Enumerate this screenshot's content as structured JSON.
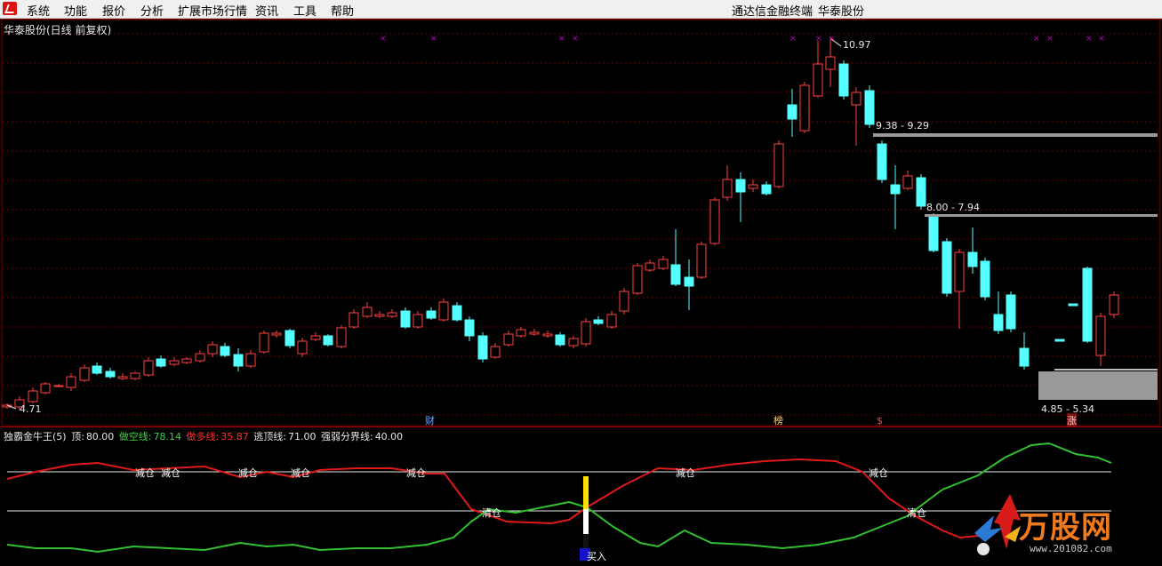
{
  "menu": {
    "items": [
      "系统",
      "功能",
      "报价",
      "分析",
      "扩展市场行情",
      "资讯",
      "工具",
      "帮助"
    ],
    "app_title": "通达信金融终端",
    "stock_name": "华泰股份"
  },
  "main_chart": {
    "title": "华泰股份(日线 前复权)",
    "high_label": "10.97",
    "low_label": "4.71",
    "zones": [
      {
        "label": "9.38 - 9.29"
      },
      {
        "label": "8.00 - 7.94"
      },
      {
        "label": "4.85 - 5.34"
      }
    ],
    "bottom_markers": [
      "财",
      "榜",
      "$",
      "涨"
    ],
    "colors": {
      "up": "#ff4040",
      "down": "#54ffff",
      "grid": "#6a0000",
      "zone": "#9a9a9a"
    }
  },
  "indicator": {
    "name": "独霸金牛王(5)",
    "params": [
      {
        "label": "顶:",
        "value": "80.00",
        "color": "#e6e6e6"
      },
      {
        "label": "做空线:",
        "value": "78.14",
        "color": "#40d040"
      },
      {
        "label": "做多线:",
        "value": "35.87",
        "color": "#ff3030"
      },
      {
        "label": "逃顶线:",
        "value": "71.00",
        "color": "#e6e6e6"
      },
      {
        "label": "强弱分界线:",
        "value": "40.00",
        "color": "#e6e6e6"
      }
    ],
    "jiancang_labels": [
      "减仓",
      "减仓",
      "减仓",
      "减仓",
      "减仓",
      "减仓",
      "减仓"
    ],
    "qingcang_labels": [
      "清仓",
      "清仓"
    ],
    "buy_label": "买入"
  },
  "watermark": {
    "text": "万股网",
    "url": "www.201082.com"
  }
}
